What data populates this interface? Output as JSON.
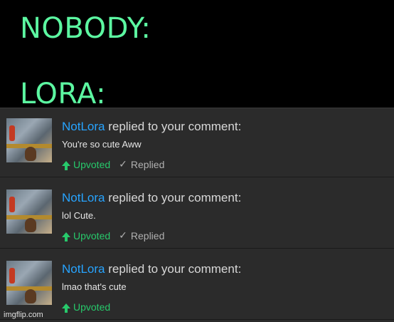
{
  "captions": {
    "line1": "NOBODY:",
    "line2": "LORA:"
  },
  "notifications": [
    {
      "username": "NotLora",
      "action": " replied to your comment:",
      "message": "You're so cute Aww",
      "upvoted_label": "Upvoted",
      "replied_label": "Replied"
    },
    {
      "username": "NotLora",
      "action": " replied to your comment:",
      "message": "lol Cute.",
      "upvoted_label": "Upvoted",
      "replied_label": "Replied"
    },
    {
      "username": "NotLora",
      "action": " replied to your comment:",
      "message": "lmao that's cute",
      "upvoted_label": "Upvoted"
    }
  ],
  "watermark": "imgflip.com",
  "colors": {
    "caption": "#5cf7a1",
    "username": "#27a4ff",
    "upvoted": "#27c96b",
    "panel": "#2b2b2b"
  }
}
